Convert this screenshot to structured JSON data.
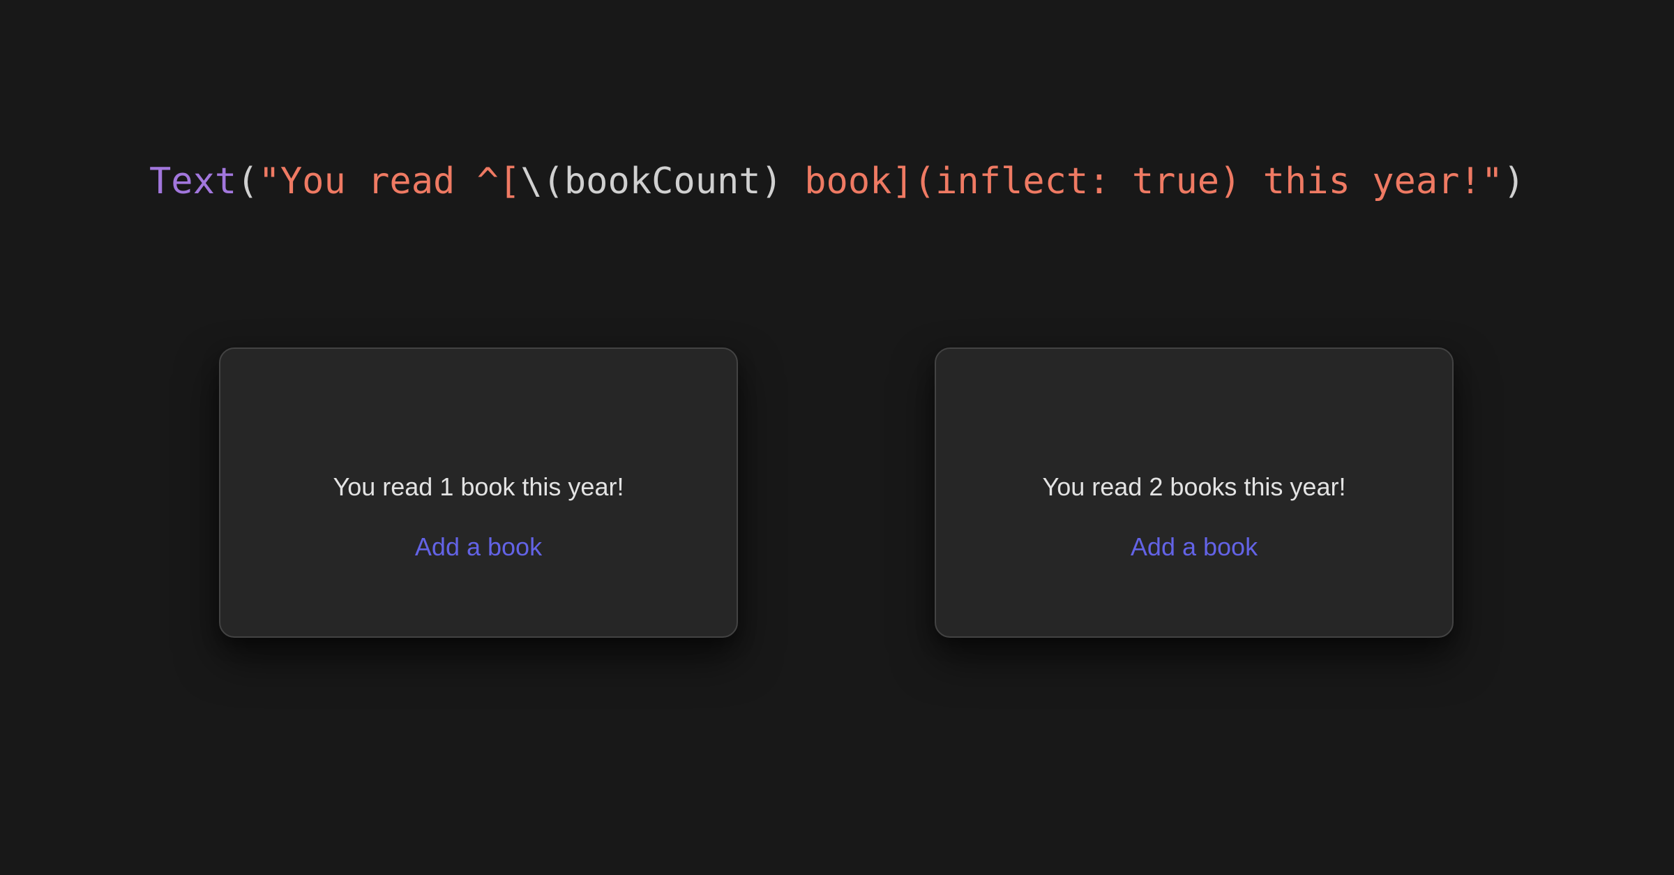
{
  "code": {
    "func": "Text",
    "open_paren": "(",
    "string_part1": "\"You read ^[",
    "interp": "\\(bookCount)",
    "string_part2": " book](inflect: true) this year!\"",
    "close_paren": ")"
  },
  "cards": [
    {
      "message": "You read 1 book this year!",
      "button_label": "Add a book"
    },
    {
      "message": "You read 2 books this year!",
      "button_label": "Add a book"
    }
  ],
  "colors": {
    "background": "#181818",
    "card_background": "#262626",
    "card_border": "#434343",
    "code_function": "#a277dd",
    "code_string": "#ef7a63",
    "code_plain": "#d0d0d0",
    "body_text": "#e3e3e3",
    "accent_link": "#6363e6"
  }
}
